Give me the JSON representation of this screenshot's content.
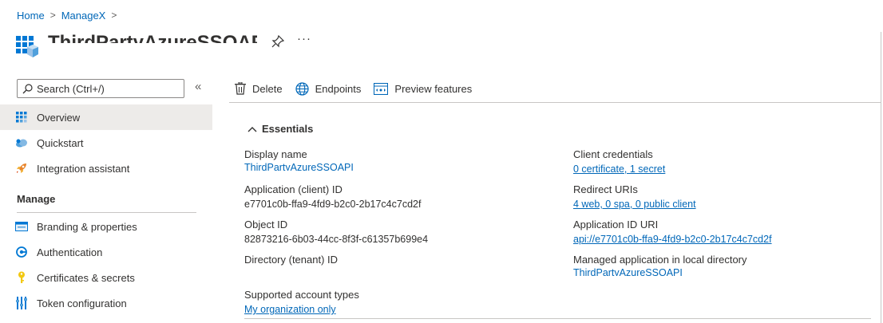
{
  "breadcrumb": [
    {
      "label": "Home"
    },
    {
      "label": "ManageX"
    }
  ],
  "header": {
    "title": "ThirdPartyAzureSSOAPI",
    "app_icon": "app-registration-icon",
    "pin_icon": "pin-icon",
    "more_label": "···"
  },
  "sidebar": {
    "search_placeholder": "Search (Ctrl+/)",
    "collapse_label": "«",
    "top_items": [
      {
        "label": "Overview",
        "icon": "overview-grid-icon",
        "selected": true
      },
      {
        "label": "Quickstart",
        "icon": "quickstart-cloud-icon"
      },
      {
        "label": "Integration assistant",
        "icon": "rocket-icon"
      }
    ],
    "section_label": "Manage",
    "manage_items": [
      {
        "label": "Branding & properties",
        "icon": "branding-icon"
      },
      {
        "label": "Authentication",
        "icon": "authentication-icon"
      },
      {
        "label": "Certificates & secrets",
        "icon": "key-icon"
      },
      {
        "label": "Token configuration",
        "icon": "token-config-icon"
      }
    ]
  },
  "toolbar": {
    "delete_label": "Delete",
    "endpoints_label": "Endpoints",
    "preview_label": "Preview features"
  },
  "essentials": {
    "label": "Essentials",
    "left": [
      {
        "label": "Display name",
        "value": "ThirdPartyAzureSSOAPI",
        "link": true,
        "clipped": true
      },
      {
        "label": "Application (client) ID",
        "value": "e7701c0b-ffa9-4fd9-b2c0-2b17c4c7cd2f"
      },
      {
        "label": "Object ID",
        "value": "82873216-6b03-44cc-8f3f-c61357b699e4"
      },
      {
        "label": "Directory (tenant) ID",
        "value": ""
      }
    ],
    "right": [
      {
        "label": "Client credentials",
        "value": "0 certificate, 1 secret",
        "link": true
      },
      {
        "label": "Redirect URIs",
        "value": "4 web, 0 spa, 0 public client",
        "link": true
      },
      {
        "label": "Application ID URI",
        "value": "api://e7701c0b-ffa9-4fd9-b2c0-2b17c4c7cd2f",
        "link": true
      },
      {
        "label": "Managed application in local directory",
        "value": "ThirdPartyAzureSSOAPI",
        "link": true,
        "clipped": true
      }
    ],
    "supported": {
      "label": "Supported account types",
      "value": "My organization only"
    }
  },
  "colors": {
    "accent": "#0067b8",
    "selected_bg": "#edebe9",
    "text": "#323130",
    "divider": "#c8c6c4"
  }
}
